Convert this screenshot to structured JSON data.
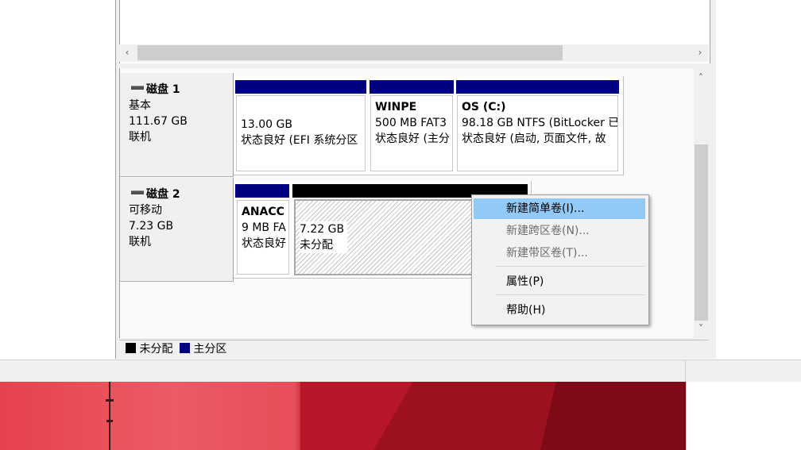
{
  "scroll_arrows": {
    "left": "‹",
    "right": "›",
    "up": "˄",
    "down": "˅"
  },
  "disks": [
    {
      "name": "磁盘 1",
      "type": "基本",
      "size": "111.67 GB",
      "status": "联机",
      "partitions": [
        {
          "label": "",
          "size": "13.00 GB",
          "status": "状态良好 (EFI 系统分区"
        },
        {
          "label": "WINPE",
          "size": "500 MB FAT3",
          "status": "状态良好 (主分"
        },
        {
          "label": "OS  (C:)",
          "size": "98.18 GB NTFS (BitLocker 已",
          "status": "状态良好 (启动, 页面文件, 故"
        }
      ]
    },
    {
      "name": "磁盘 2",
      "type": "可移动",
      "size": "7.23 GB",
      "status": "联机",
      "partitions": [
        {
          "label": "ANACC",
          "size": "9 MB FA",
          "status": "状态良好"
        },
        {
          "label": "",
          "size": "7.22 GB",
          "status": "未分配"
        }
      ]
    }
  ],
  "legend": {
    "unallocated": "未分配",
    "primary": "主分区"
  },
  "context_menu": [
    {
      "label": "新建简单卷(I)...",
      "state": "highlighted"
    },
    {
      "label": "新建跨区卷(N)...",
      "state": "disabled"
    },
    {
      "label": "新建带区卷(T)...",
      "state": "disabled"
    },
    {
      "label": "属性(P)",
      "state": "normal"
    },
    {
      "label": "帮助(H)",
      "state": "normal"
    }
  ],
  "colors": {
    "primary_partition": "#000080",
    "unallocated": "#000000",
    "highlight": "#91c9f7",
    "wallpaper": "#b0182a"
  }
}
